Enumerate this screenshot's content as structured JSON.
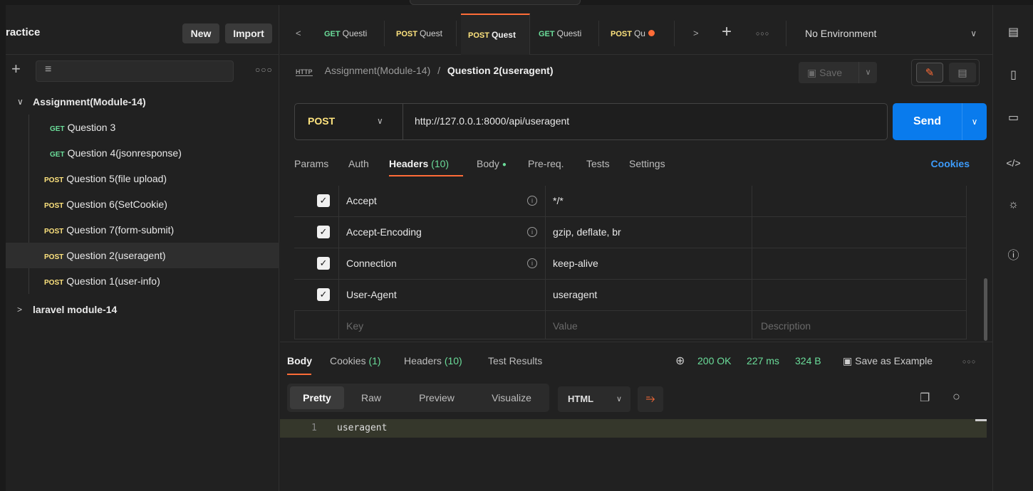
{
  "workspace": {
    "name": "ractice",
    "new_label": "New",
    "import_label": "Import"
  },
  "sidebar": {
    "collections": [
      {
        "name": "Assignment(Module-14)",
        "expanded": true,
        "items": [
          {
            "method": "GET",
            "name": "Question 3"
          },
          {
            "method": "GET",
            "name": "Question 4(jsonresponse)"
          },
          {
            "method": "POST",
            "name": "Question 5(file upload)"
          },
          {
            "method": "POST",
            "name": "Question 6(SetCookie)"
          },
          {
            "method": "POST",
            "name": "Question 7(form-submit)"
          },
          {
            "method": "POST",
            "name": "Question 2(useragent)",
            "selected": true
          },
          {
            "method": "POST",
            "name": "Question 1(user-info)"
          }
        ]
      },
      {
        "name": "laravel module-14",
        "expanded": false
      }
    ]
  },
  "tabs": [
    {
      "method": "GET",
      "name": "Questi"
    },
    {
      "method": "POST",
      "name": "Quest"
    },
    {
      "method": "POST",
      "name": "Quest",
      "active": true
    },
    {
      "method": "GET",
      "name": "Questi"
    },
    {
      "method": "POST",
      "name": "Qu",
      "unsaved": true
    }
  ],
  "environment": "No Environment",
  "request": {
    "collection": "Assignment(Module-14)",
    "separator": "/",
    "name": "Question 2(useragent)",
    "save_label": "Save",
    "method": "POST",
    "url": "http://127.0.0.1:8000/api/useragent",
    "send_label": "Send",
    "tabs": {
      "params": "Params",
      "auth": "Auth",
      "headers": "Headers",
      "headers_count": "(10)",
      "body": "Body",
      "prereq": "Pre-req.",
      "tests": "Tests",
      "settings": "Settings",
      "cookies": "Cookies"
    },
    "headers": [
      {
        "key": "Accept",
        "value": "*/*",
        "checked": true,
        "info": true
      },
      {
        "key": "Accept-Encoding",
        "value": "gzip, deflate, br",
        "checked": true,
        "info": true
      },
      {
        "key": "Connection",
        "value": "keep-alive",
        "checked": true,
        "info": true
      },
      {
        "key": "User-Agent",
        "value": "useragent",
        "checked": true,
        "info": false
      }
    ],
    "placeholders": {
      "key": "Key",
      "value": "Value",
      "description": "Description"
    }
  },
  "response": {
    "tabs": {
      "body": "Body",
      "cookies": "Cookies",
      "cookies_count": "(1)",
      "headers": "Headers",
      "headers_count": "(10)",
      "test_results": "Test Results"
    },
    "status": "200 OK",
    "time": "227 ms",
    "size": "324 B",
    "save_example": "Save as Example",
    "views": [
      "Pretty",
      "Raw",
      "Preview",
      "Visualize"
    ],
    "language": "HTML",
    "lines": [
      {
        "num": "1",
        "text": "useragent"
      }
    ]
  },
  "colors": {
    "accent": "#ff6c37",
    "send": "#097bed",
    "get": "#6bdd9a",
    "post": "#ffe47e",
    "status_ok": "#6bdd9a"
  }
}
